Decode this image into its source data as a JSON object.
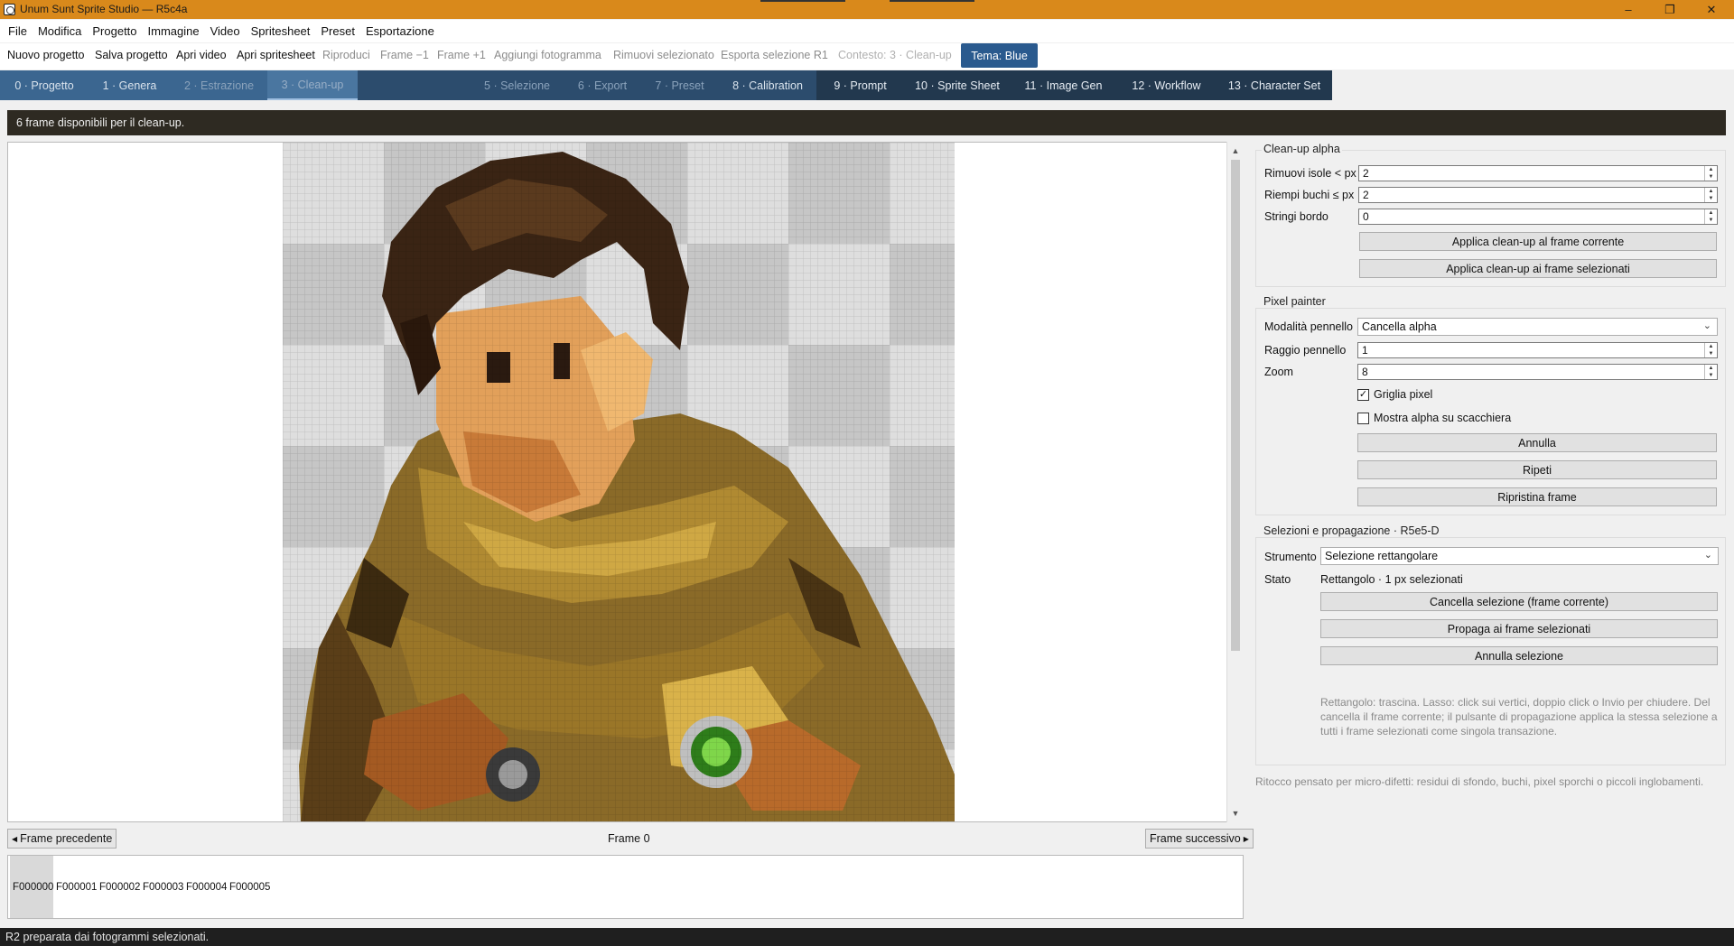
{
  "window": {
    "title": "Unum Sunt Sprite Studio — R5c4a",
    "controls": {
      "minimize": "–",
      "maximize": "❐",
      "close": "✕"
    }
  },
  "menu": [
    "File",
    "Modifica",
    "Progetto",
    "Immagine",
    "Video",
    "Spritesheet",
    "Preset",
    "Esportazione"
  ],
  "toolbar": {
    "new_project": "Nuovo progetto",
    "save_project": "Salva progetto",
    "open_video": "Apri video",
    "open_spritesheet": "Apri spritesheet",
    "play": "Riproduci",
    "frame_prev": "Frame −1",
    "frame_next": "Frame +1",
    "add_frame": "Aggiungi fotogramma",
    "remove_selected": "Rimuovi selezionato",
    "export_selection": "Esporta selezione R1",
    "context": "Contesto: 3 · Clean-up",
    "theme": "Tema: Blue"
  },
  "steps": [
    "0 · Progetto",
    "1 · Genera",
    "2 · Estrazione",
    "3 · Clean-up",
    "",
    "5 · Selezione",
    "6 · Export",
    "7 · Preset",
    "8 · Calibration",
    "9 · Prompt",
    "10 · Sprite Sheet",
    "11 · Image Gen",
    "12 · Workflow",
    "13 · Character Set"
  ],
  "banner": "6 frame disponibili per il clean-up.",
  "navigation": {
    "prev": "Frame precedente",
    "next": "Frame successivo",
    "current": "Frame 0"
  },
  "frames": [
    "F000000",
    "F000001",
    "F000002",
    "F000003",
    "F000004",
    "F000005"
  ],
  "selected_frame_index": 0,
  "status": "R2 preparata dai fotogrammi selezionati.",
  "cleanup": {
    "title": "Clean-up alpha",
    "islands_label": "Rimuovi isole < px",
    "islands_value": "2",
    "holes_label": "Riempi buchi ≤ px",
    "holes_value": "2",
    "shrink_label": "Stringi bordo",
    "shrink_value": "0",
    "apply_current": "Applica clean-up al frame corrente",
    "apply_selected": "Applica clean-up ai frame selezionati"
  },
  "painter": {
    "title": "Pixel painter",
    "mode_label": "Modalità pennello",
    "mode_value": "Cancella alpha",
    "radius_label": "Raggio pennello",
    "radius_value": "1",
    "zoom_label": "Zoom",
    "zoom_value": "8",
    "grid_label": "Griglia pixel",
    "grid_checked": true,
    "alpha_label": "Mostra alpha su scacchiera",
    "alpha_checked": false,
    "undo": "Annulla",
    "redo": "Ripeti",
    "restore": "Ripristina frame"
  },
  "selections": {
    "title": "Selezioni e propagazione · R5e5-D",
    "tool_label": "Strumento",
    "tool_value": "Selezione rettangolare",
    "state_label": "Stato",
    "state_value": "Rettangolo · 1 px selezionati",
    "clear_current": "Cancella selezione (frame corrente)",
    "propagate": "Propaga ai frame selezionati",
    "cancel": "Annulla selezione",
    "hint_line1": "Rettangolo: trascina. Lasso: click sui vertici, doppio click o Invio per chiudere. Del",
    "hint_line2": "cancella il frame corrente; il pulsante di propagazione applica la stessa selezione a",
    "hint_line3": "tutti i frame selezionati come singola transazione."
  },
  "footer_hint": "Ritocco pensato per micro-difetti: residui di sfondo, buchi, pixel sporchi o piccoli inglobamenti.",
  "colors": {
    "titlebar": "#d9891b",
    "steps_bg": "#3b6690",
    "steps_dark": "#22384e",
    "theme_button": "#2a5a8e",
    "banner": "#2e2a22",
    "statusbar": "#1f1f1f"
  }
}
